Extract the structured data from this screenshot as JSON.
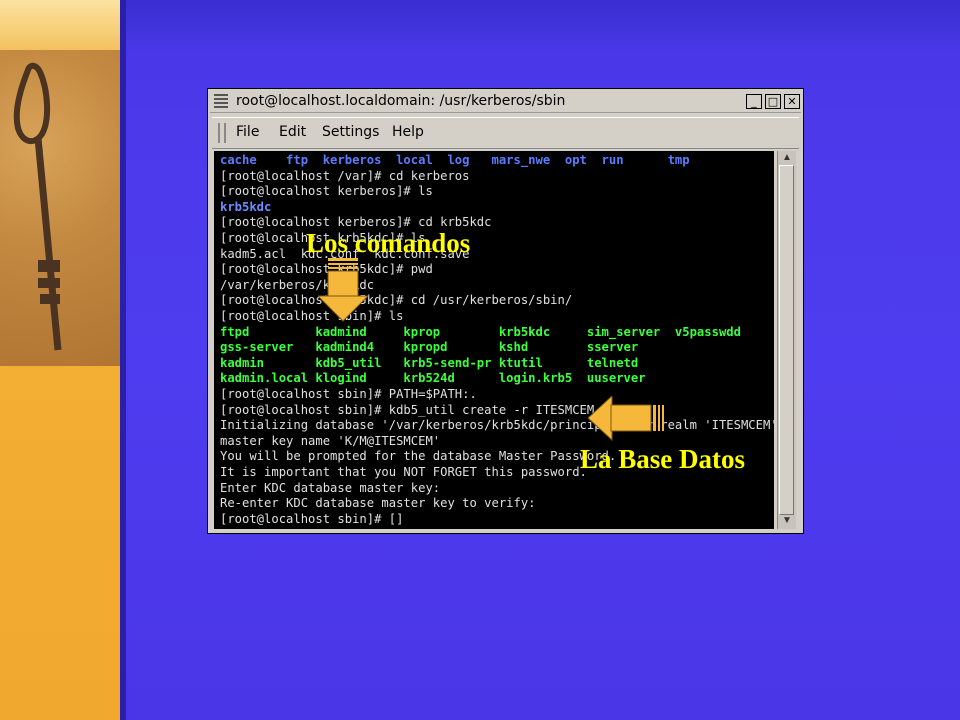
{
  "window": {
    "title": "root@localhost.localdomain: /usr/kerberos/sbin",
    "min_label": "_",
    "max_label": "□",
    "close_label": "✕"
  },
  "menu": {
    "file": "File",
    "edit": "Edit",
    "settings": "Settings",
    "help": "Help"
  },
  "terminal": {
    "lines": [
      "cache    ftp  kerberos  local  log   mars_nwe  opt  run      tmp",
      "[root@localhost /var]# cd kerberos",
      "[root@localhost kerberos]# ls",
      "krb5kdc",
      "[root@localhost kerberos]# cd krb5kdc",
      "[root@localhost krb5kdc]# ls",
      "kadm5.acl  kdc.conf  kdc.conf.save",
      "[root@localhost krb5kdc]# pwd",
      "/var/kerberos/krb5kdc",
      "[root@localhost krb5kdc]# cd /usr/kerberos/sbin/",
      "[root@localhost sbin]# ls",
      "ftpd         kadmind     kprop        krb5kdc     sim_server  v5passwdd",
      "gss-server   kadmind4    kpropd       kshd        sserver",
      "kadmin       kdb5_util   krb5-send-pr ktutil      telnetd",
      "kadmin.local klogind     krb524d      login.krb5  uuserver",
      "[root@localhost sbin]# PATH=$PATH:.",
      "[root@localhost sbin]# kdb5_util create -r ITESMCEM -s",
      "Initializing database '/var/kerberos/krb5kdc/principal' for realm 'ITESMCEM',",
      "master key name 'K/M@ITESMCEM'",
      "You will be prompted for the database Master Password.",
      "It is important that you NOT FORGET this password.",
      "Enter KDC database master key:",
      "Re-enter KDC database master key to verify:",
      "[root@localhost sbin]# []"
    ]
  },
  "annotations": {
    "commands": "Los comandos",
    "database": "La Base Datos"
  },
  "colors": {
    "background": "#4e3cf0",
    "annotation": "#ffff00",
    "arrow": "#f5b83a",
    "dir_listing": "#5c7cff",
    "exec_listing": "#3cff3c"
  }
}
